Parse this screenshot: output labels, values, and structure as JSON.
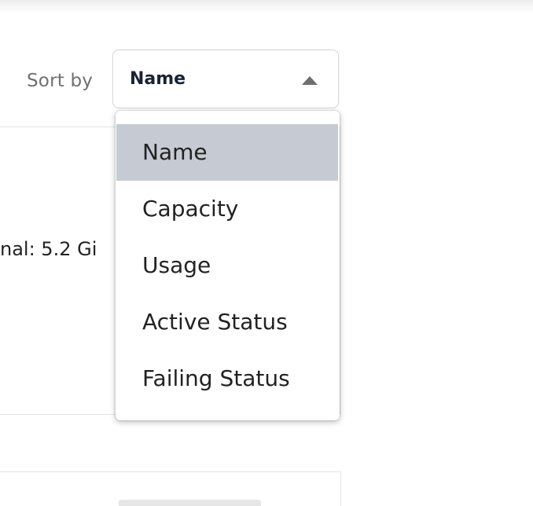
{
  "sort": {
    "label": "Sort by",
    "selected": "Name",
    "options": [
      "Name",
      "Capacity",
      "Usage",
      "Active Status",
      "Failing Status"
    ],
    "highlighted_index": 0
  },
  "background_card": {
    "partial_text": "nal: 5.2 Gi"
  },
  "colors": {
    "highlight": "#c6cbd3",
    "text": "#222222",
    "label": "#707070"
  }
}
